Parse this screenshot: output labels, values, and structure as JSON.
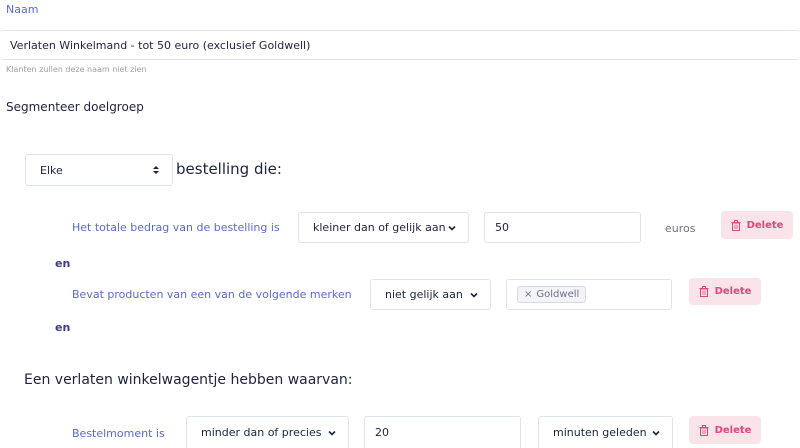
{
  "name_field": {
    "label": "Naam",
    "value": "Verlaten Winkelmand - tot 50 euro (exclusief Goldwell)",
    "hint": "Klanten zullen deze naam niet zien"
  },
  "segment": {
    "title": "Segmenteer doelgroep",
    "scope_select": "Elke",
    "scope_suffix": "bestelling die:",
    "conditions": [
      {
        "label": "Het totale bedrag van de bestelling is",
        "operator": "kleiner dan of gelijk aan",
        "value": "50",
        "unit": "euros",
        "delete_label": "Delete"
      },
      {
        "label": "Bevat producten van een van de volgende merken",
        "operator": "niet gelijk aan",
        "tag": "Goldwell",
        "delete_label": "Delete"
      }
    ],
    "connector": "en"
  },
  "abandoned": {
    "title": "Een verlaten winkelwagentje hebben waarvan:",
    "condition": {
      "label": "Bestelmoment is",
      "operator": "minder dan of precies",
      "value": "20",
      "unit": "minuten geleden",
      "delete_label": "Delete"
    }
  },
  "colors": {
    "accent": "#5a6ad0",
    "danger": "#e0467a",
    "danger_bg": "#fbe3ea"
  }
}
